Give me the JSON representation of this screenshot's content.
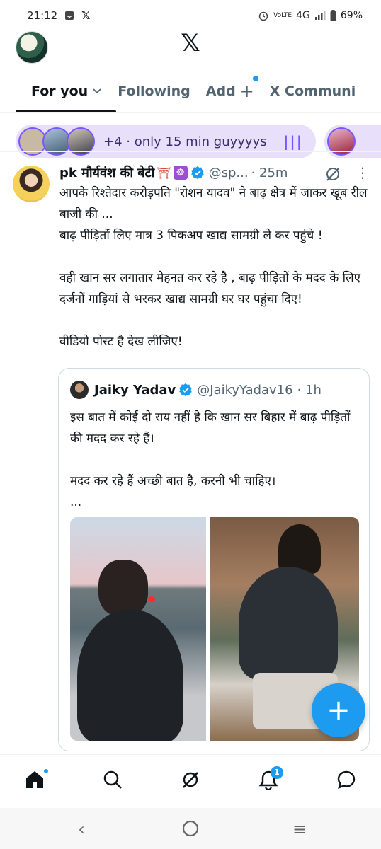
{
  "status_bar": {
    "time": "21:12",
    "network": "4G",
    "volte": "VoLTE",
    "battery": "69%"
  },
  "tabs": [
    {
      "label": "For you"
    },
    {
      "label": "Following"
    },
    {
      "label": "Add"
    },
    {
      "label": "X Communi"
    }
  ],
  "spaces": {
    "count_text": "+4 · only 15 min guyyyys"
  },
  "post": {
    "name": "pk मौर्यवंश की बेटी",
    "handle": "@sp...",
    "time": "· 25m",
    "text": "आपके रिश्तेदार करोड़पति \"रोशन यादव\" ने बाढ़ क्षेत्र में जाकर खूब रील बाजी की ...\nबाढ़ पीड़ितों लिए मात्र 3 पिकअप खाद्य सामग्री ले कर पहुंचे !\n\nवही खान सर लगातार मेहनत कर रहे है , बाढ़ पीड़ितों के मदद के लिए दर्जनों गाड़ियां से भरकर खाद्य सामग्री घर घर पहुंचा दिए!\n\nवीडियो पोस्ट है देख लीजिए!"
  },
  "quote": {
    "name": "Jaiky Yadav",
    "handle": "@JaikyYadav16",
    "time": "· 1h",
    "text": "इस बात में कोई दो राय नहीं है कि खान सर बिहार में बाढ़ पीड़ितों की मदद कर रहे हैं।\n\nमदद कर रहे हैं अच्छी बात है, करनी भी चाहिए।\n..."
  },
  "nav": {
    "notification_count": "1"
  },
  "colors": {
    "accent": "#1d9bf0",
    "spaces": "#7856ff"
  }
}
